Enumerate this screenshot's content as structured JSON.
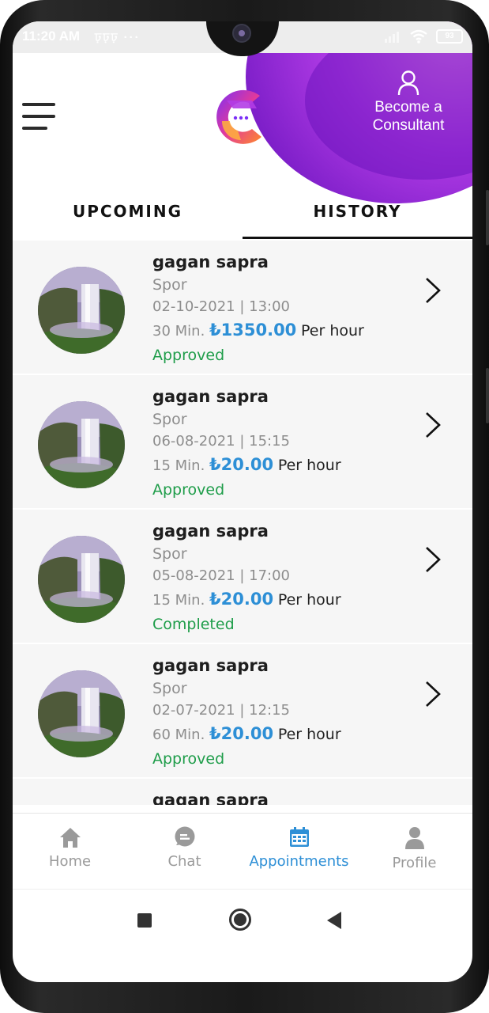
{
  "status_bar": {
    "time": "11:20 AM",
    "notifications": "ঢ়ঢ়ঢ় ···",
    "battery": "93"
  },
  "header": {
    "become_consultant": "Become a Consultant"
  },
  "tabs": [
    {
      "label": "UPCOMING",
      "active": false
    },
    {
      "label": "HISTORY",
      "active": true
    }
  ],
  "appointments": [
    {
      "name": "gagan sapra",
      "category": "Spor",
      "datetime": "02-10-2021 | 13:00",
      "duration": "30 Min.",
      "price": "₺1350.00",
      "rate_unit": "Per hour",
      "status": "Approved"
    },
    {
      "name": "gagan sapra",
      "category": "Spor",
      "datetime": "06-08-2021 | 15:15",
      "duration": "15 Min.",
      "price": "₺20.00",
      "rate_unit": "Per hour",
      "status": "Approved"
    },
    {
      "name": "gagan sapra",
      "category": "Spor",
      "datetime": "05-08-2021 | 17:00",
      "duration": "15 Min.",
      "price": "₺20.00",
      "rate_unit": "Per hour",
      "status": "Completed"
    },
    {
      "name": "gagan sapra",
      "category": "Spor",
      "datetime": "02-07-2021 | 12:15",
      "duration": "60 Min.",
      "price": "₺20.00",
      "rate_unit": "Per hour",
      "status": "Approved"
    },
    {
      "name": "gagan sapra",
      "category": "",
      "datetime": "",
      "duration": "",
      "price": "",
      "rate_unit": "",
      "status": ""
    }
  ],
  "bottom_nav": [
    {
      "label": "Home",
      "icon": "home-icon",
      "active": false
    },
    {
      "label": "Chat",
      "icon": "chat-icon",
      "active": false
    },
    {
      "label": "Appointments",
      "icon": "calendar-icon",
      "active": true
    },
    {
      "label": "Profile",
      "icon": "profile-icon",
      "active": false
    }
  ],
  "colors": {
    "accent": "#2d8fd6",
    "status_green": "#1f9d4a",
    "header_purple": "#9b30e0"
  }
}
